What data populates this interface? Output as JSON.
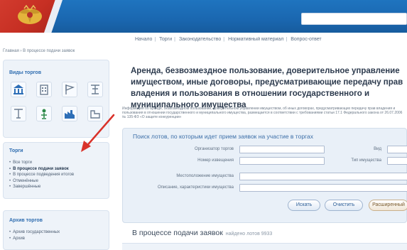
{
  "header": {
    "search_placeholder": ""
  },
  "topnav": {
    "items": [
      "Начало",
      "Торги",
      "Законодательство",
      "Нормативный материал",
      "Вопрос-ответ"
    ]
  },
  "breadcrumb": "Главная › В процессе подачи заявок",
  "sidebar": {
    "types_title": "Виды торгов",
    "types_icons": [
      "bank-icon",
      "building-icon",
      "flag-icon",
      "tools-icon",
      "document-icon",
      "person-icon",
      "factory-icon",
      "house-icon"
    ],
    "auctions_title": "Торги",
    "auctions_items": [
      {
        "label": "Все торги",
        "active": false
      },
      {
        "label": "В процессе подачи заявок",
        "active": true
      },
      {
        "label": "В процессе подведения итогов",
        "active": false
      },
      {
        "label": "Отменённые",
        "active": false
      },
      {
        "label": "Завершённые",
        "active": false
      }
    ],
    "archive_title": "Архив торгов",
    "archive_items": [
      {
        "label": "Архив государственных"
      },
      {
        "label": "Архив"
      }
    ]
  },
  "main": {
    "title": "Аренда, безвозмездное пользование, доверительное управление имуществом, иные договоры, предусматривающие передачу прав владения и пользования в отношении государственного и муниципального имущества",
    "description": "Информация об аренде, безвозмездном пользовании, доверительном управлении имуществом, об иных договорах, предусматривающих передачу прав владения и пользования в отношении государственного и муниципального имущества, размещается в соответствии с требованиями статьи 17.1 Федерального закона от 26.07.2006 № 135-ФЗ «О защите конкуренции»",
    "form": {
      "title": "Поиск лотов, по которым идет прием заявок на участие в торгах",
      "fields": {
        "organizer_label": "Организатор торгов",
        "type_label": "Вид",
        "notice_label": "Номер извещения",
        "lot_label": "Тип имущества",
        "property_label": "Местоположение имущества",
        "desc_label": "Описание, характеристики имущества"
      },
      "buttons": {
        "search": "Искать",
        "clear": "Очистить",
        "extended": "Расширенный"
      }
    },
    "results": {
      "heading": "В процессе подачи заявок",
      "count": "найдено лотов 9933"
    }
  },
  "colors": {
    "header_blue": "#1f74bf",
    "flag_red": "#d23b2e",
    "link_blue": "#2f6db0",
    "arrow_red": "#d9322a"
  }
}
